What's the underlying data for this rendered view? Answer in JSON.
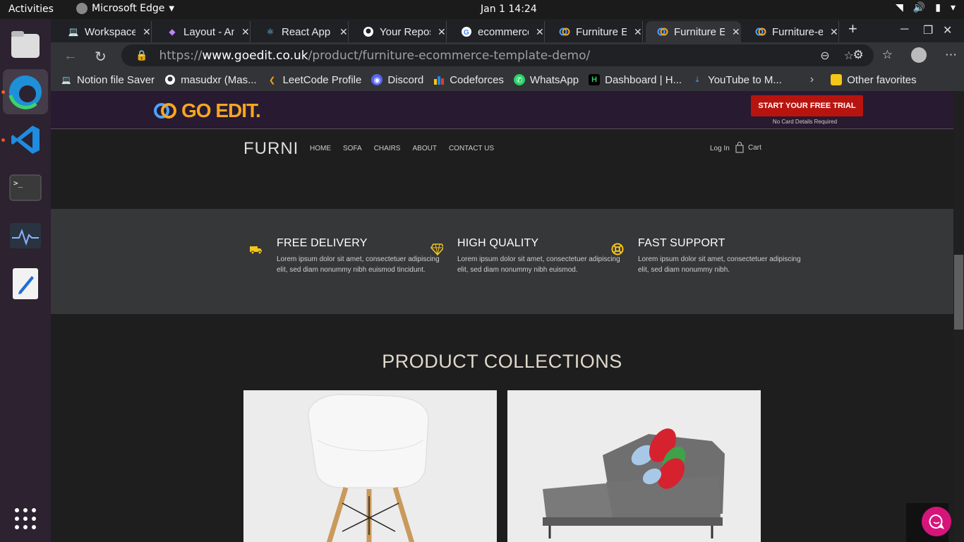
{
  "os": {
    "activities": "Activities",
    "app_name": "Microsoft Edge",
    "clock": "Jan 1  14:24"
  },
  "tabs": [
    {
      "title": "Workspace",
      "icon": "laptop-icon"
    },
    {
      "title": "Layout - An",
      "icon": "diamond-icon"
    },
    {
      "title": "React App",
      "icon": "react-icon"
    },
    {
      "title": "Your Repos",
      "icon": "github-icon"
    },
    {
      "title": "ecommerce",
      "icon": "google-icon"
    },
    {
      "title": "Furniture E",
      "icon": "goedit-icon"
    },
    {
      "title": "Furniture E",
      "icon": "goedit-icon"
    },
    {
      "title": "Furniture-e",
      "icon": "goedit-icon"
    }
  ],
  "address": {
    "prefix": "https://",
    "host": "www.goedit.co.uk",
    "path": "/product/furniture-ecommerce-template-demo/"
  },
  "favorites": [
    {
      "label": "Notion file Saver",
      "icon": "laptop-icon"
    },
    {
      "label": "masudxr (Mas...",
      "icon": "github-icon"
    },
    {
      "label": "LeetCode Profile",
      "icon": "leetcode-icon"
    },
    {
      "label": "Discord",
      "icon": "discord-icon"
    },
    {
      "label": "Codeforces",
      "icon": "codeforces-icon"
    },
    {
      "label": "WhatsApp",
      "icon": "whatsapp-icon"
    },
    {
      "label": "Dashboard | H...",
      "icon": "dashboard-icon"
    },
    {
      "label": "YouTube to M...",
      "icon": "download-icon"
    }
  ],
  "other_favorites": "Other favorites",
  "goedit": {
    "logo_text": "GO EDIT.",
    "trial_button": "START YOUR FREE TRIAL",
    "trial_note": "No Card Details Required"
  },
  "site": {
    "brand": "FURNI",
    "menu": [
      "HOME",
      "SOFA",
      "CHAIRS",
      "ABOUT",
      "CONTACT US"
    ],
    "login": "Log In",
    "cart": "Cart"
  },
  "features": [
    {
      "title": "FREE DELIVERY",
      "text": "Lorem ipsum dolor sit amet, consectetuer adipiscing elit, sed diam nonummy nibh euismod tincidunt.",
      "icon": "truck-icon"
    },
    {
      "title": "HIGH QUALITY",
      "text": "Lorem ipsum dolor sit amet, consectetuer adipiscing elit, sed diam nonummy nibh euismod.",
      "icon": "diamond-icon"
    },
    {
      "title": "FAST SUPPORT",
      "text": "Lorem ipsum dolor sit amet, consectetuer adipiscing elit, sed diam nonummy nibh.",
      "icon": "lifebuoy-icon"
    }
  ],
  "collections": {
    "title": "PRODUCT COLLECTIONS"
  },
  "colors": {
    "accent": "#f5c518",
    "trial_red": "#b8140f",
    "chat_pink": "#d6157b",
    "goedit_orange": "#f5a623"
  }
}
